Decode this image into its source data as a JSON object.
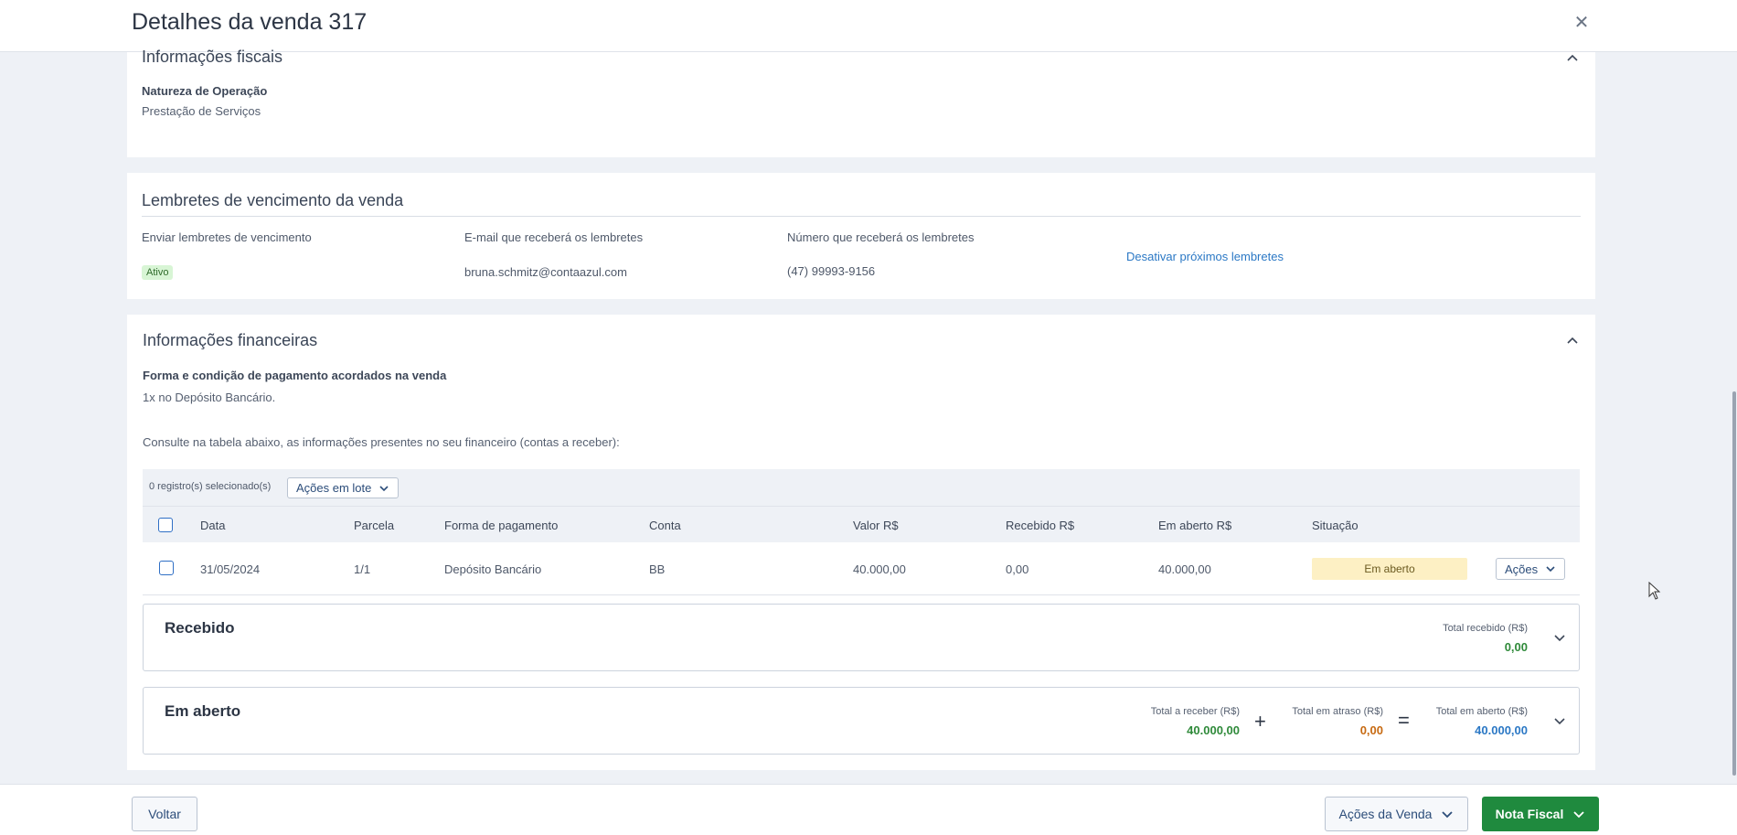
{
  "header": {
    "title": "Detalhes da venda 317",
    "close_icon": "close-icon"
  },
  "fiscal": {
    "title": "Informações fiscais",
    "natureza_label": "Natureza de Operação",
    "natureza_value": "Prestação de Serviços"
  },
  "reminders": {
    "title": "Lembretes de vencimento da venda",
    "send_label": "Enviar lembretes de vencimento",
    "send_status": "Ativo",
    "email_label": "E-mail que receberá os lembretes",
    "email_value": "bruna.schmitz@contaazul.com",
    "phone_label": "Número que receberá os lembretes",
    "phone_value": "(47) 99993-9156",
    "disable_link": "Desativar próximos lembretes"
  },
  "financial": {
    "title": "Informações financeiras",
    "payment_label": "Forma e condição de pagamento acordados na venda",
    "payment_value": "1x no Depósito Bancário.",
    "table_hint": "Consulte na tabela abaixo, as informações presentes no seu financeiro (contas a receber):",
    "selected_count": "0 registro(s) selecionado(s)",
    "batch_actions": "Ações em lote",
    "columns": {
      "data": "Data",
      "parcela": "Parcela",
      "forma": "Forma de pagamento",
      "conta": "Conta",
      "valor": "Valor R$",
      "recebido": "Recebido R$",
      "em_aberto": "Em aberto R$",
      "situacao": "Situação"
    },
    "rows": [
      {
        "data": "31/05/2024",
        "parcela": "1/1",
        "forma": "Depósito Bancário",
        "conta": "BB",
        "valor": "40.000,00",
        "recebido": "0,00",
        "em_aberto": "40.000,00",
        "situacao": "Em aberto",
        "acoes": "Ações"
      }
    ],
    "received_panel": {
      "title": "Recebido",
      "total_label": "Total recebido (R$)",
      "total_value": "0,00"
    },
    "open_panel": {
      "title": "Em aberto",
      "receber_label": "Total a receber (R$)",
      "receber_value": "40.000,00",
      "plus": "+",
      "atraso_label": "Total em atraso (R$)",
      "atraso_value": "0,00",
      "equals": "=",
      "aberto_label": "Total em aberto (R$)",
      "aberto_value": "40.000,00"
    }
  },
  "footer": {
    "back": "Voltar",
    "sale_actions": "Ações da Venda",
    "invoice": "Nota Fiscal"
  },
  "colors": {
    "green": "#2f8a3a",
    "orange": "#c76a12",
    "blue": "#2b78c5",
    "primary_button": "#1f8a3e"
  }
}
